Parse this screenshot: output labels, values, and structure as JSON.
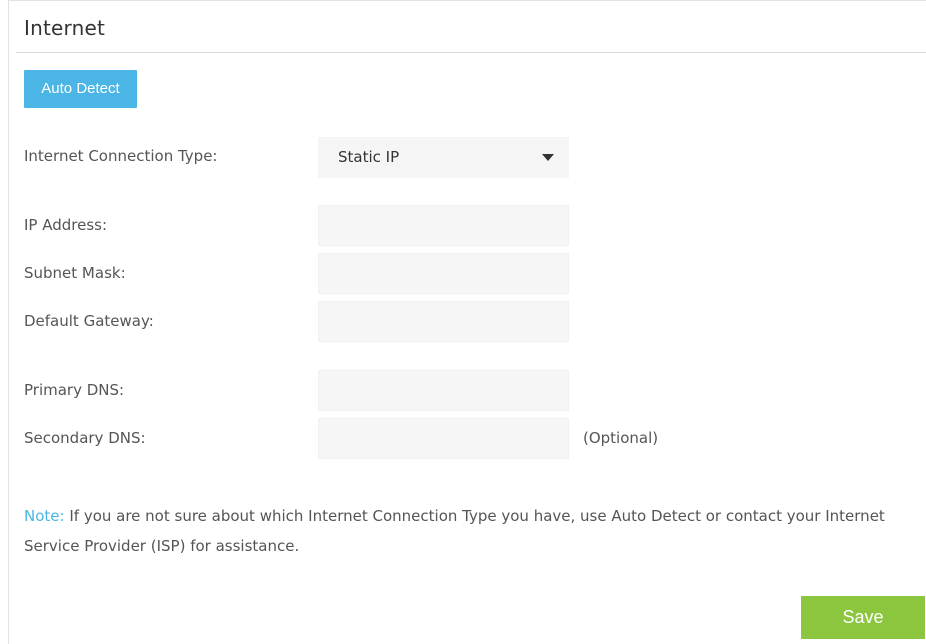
{
  "section": {
    "title": "Internet"
  },
  "auto_detect_button": {
    "label": "Auto Detect"
  },
  "connection_type": {
    "label": "Internet Connection Type:",
    "selected": "Static IP"
  },
  "fields": {
    "ip_address": {
      "label": "IP Address:",
      "value": ""
    },
    "subnet_mask": {
      "label": "Subnet Mask:",
      "value": ""
    },
    "default_gateway": {
      "label": "Default Gateway:",
      "value": ""
    },
    "primary_dns": {
      "label": "Primary DNS:",
      "value": ""
    },
    "secondary_dns": {
      "label": "Secondary DNS:",
      "value": "",
      "hint": "(Optional)"
    }
  },
  "note": {
    "prefix": "Note:",
    "text": "If you are not sure about which Internet Connection Type you have, use Auto Detect or contact your Internet Service Provider (ISP) for assistance."
  },
  "save_button": {
    "label": "Save"
  },
  "colors": {
    "accent_blue": "#4bb6e6",
    "save_green": "#8cc63f",
    "field_bg": "#f6f6f6"
  },
  "icons": {
    "dropdown": "caret-down-icon"
  }
}
